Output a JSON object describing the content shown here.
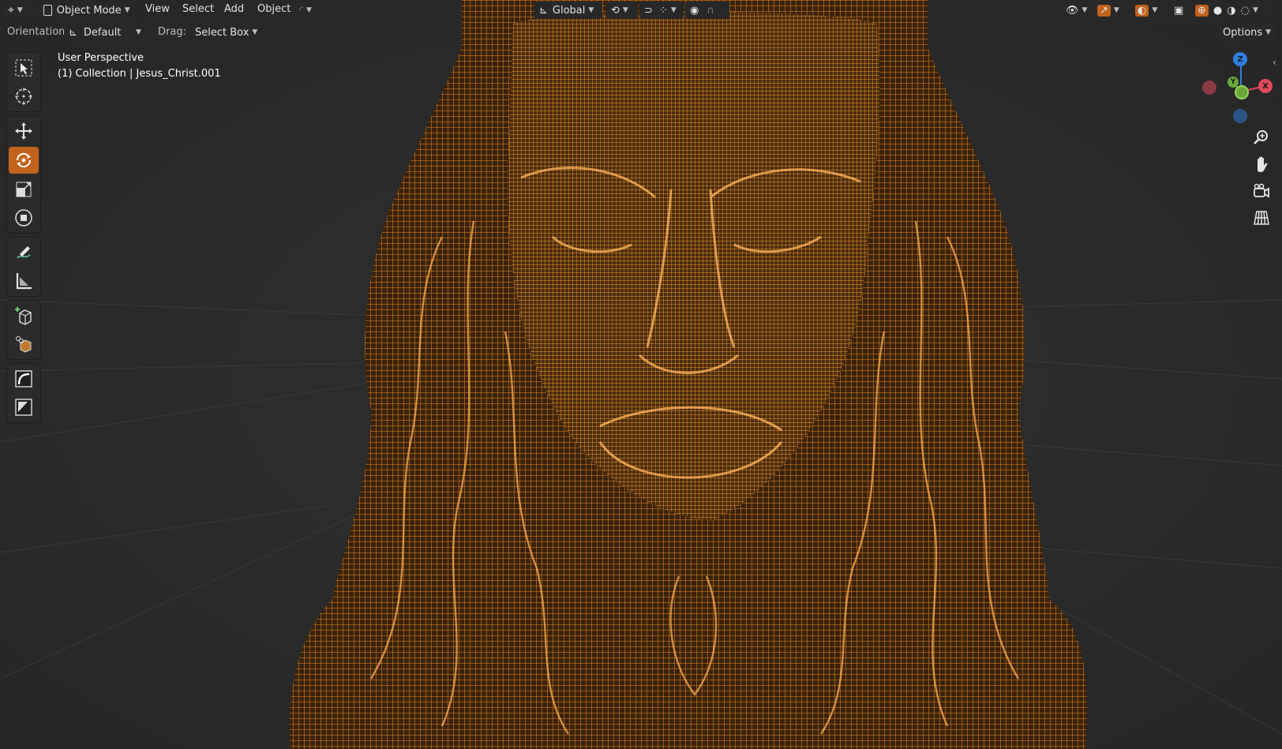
{
  "header": {
    "mode": "Object Mode",
    "menus": [
      "View",
      "Select",
      "Add",
      "Object"
    ],
    "transform_orientation": "Global"
  },
  "tool_settings": {
    "orientation_label": "Orientation:",
    "orientation_value": "Default",
    "drag_label": "Drag:",
    "drag_value": "Select Box",
    "options": "Options"
  },
  "viewport": {
    "view_name": "User Perspective",
    "object_info": "(1) Collection | Jesus_Christ.001",
    "wire_color": "#f0901f",
    "background": "#2a2a2a"
  },
  "gizmo": {
    "z_label": "Z",
    "y_label": "Y",
    "x_label": "X"
  },
  "toolbar": {
    "tools": [
      "select-box-icon",
      "cursor-icon",
      "move-icon",
      "rotate-icon",
      "scale-icon",
      "transform-icon",
      "annotate-icon",
      "measure-icon",
      "add-cube-icon",
      "scale-cage-icon",
      "curve-icon",
      "image-icon"
    ],
    "active_tool": "rotate-icon"
  }
}
